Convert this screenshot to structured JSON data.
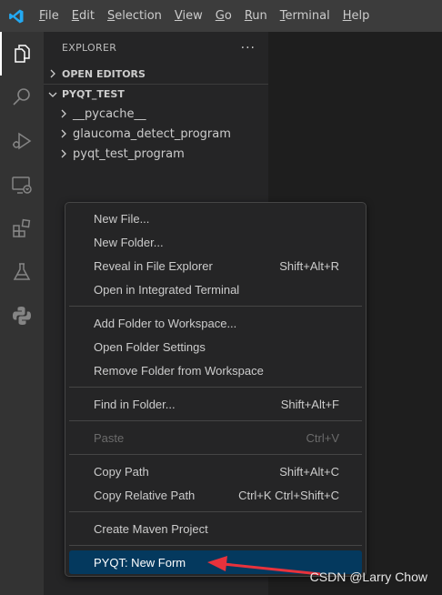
{
  "menubar": {
    "items": [
      "File",
      "Edit",
      "Selection",
      "View",
      "Go",
      "Run",
      "Terminal",
      "Help"
    ],
    "mnemonics": [
      "F",
      "E",
      "S",
      "V",
      "G",
      "R",
      "T",
      "H"
    ]
  },
  "activitybar": {
    "icons": [
      "explorer-icon",
      "search-icon",
      "run-debug-icon",
      "remote-explorer-icon",
      "extensions-icon",
      "testing-icon",
      "python-icon"
    ]
  },
  "sidebar": {
    "title": "EXPLORER",
    "more": "···",
    "open_editors": "OPEN EDITORS",
    "project": "PYQT_TEST",
    "tree": [
      "__pycache__",
      "glaucoma_detect_program",
      "pyqt_test_program"
    ]
  },
  "context_menu": {
    "new_file": "New File...",
    "new_folder": "New Folder...",
    "reveal": "Reveal in File Explorer",
    "reveal_key": "Shift+Alt+R",
    "open_terminal": "Open in Integrated Terminal",
    "add_folder": "Add Folder to Workspace...",
    "open_folder_settings": "Open Folder Settings",
    "remove_folder": "Remove Folder from Workspace",
    "find_in_folder": "Find in Folder...",
    "find_key": "Shift+Alt+F",
    "paste": "Paste",
    "paste_key": "Ctrl+V",
    "copy_path": "Copy Path",
    "copy_path_key": "Shift+Alt+C",
    "copy_relative": "Copy Relative Path",
    "copy_relative_key": "Ctrl+K Ctrl+Shift+C",
    "maven": "Create Maven Project",
    "pyqt_new_form": "PYQT: New Form"
  },
  "watermark": "CSDN @Larry Chow",
  "colors": {
    "accent": "#007acc",
    "selection": "#04395e",
    "arrow": "#e8323c"
  }
}
